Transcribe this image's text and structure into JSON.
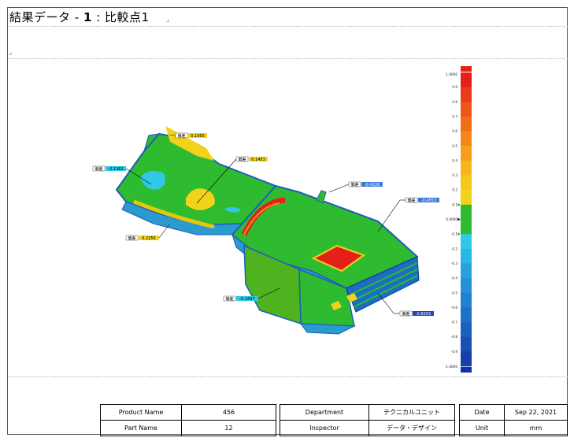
{
  "header": {
    "title_prefix": "結果データ - ",
    "title_num": "1",
    "title_sep": " :  ",
    "title_name": "比較点1"
  },
  "colors": {
    "accent": "#2a6cc7",
    "green": "#2fbb2f",
    "red": "#e5201a",
    "yellow": "#f2d21a"
  },
  "callouts": [
    {
      "label": "偏差",
      "value": "0.1065",
      "color": "#f2d21a"
    },
    {
      "label": "偏差",
      "value": "0.1453",
      "color": "#f2d21a"
    },
    {
      "label": "偏差",
      "value": "-0.1362",
      "color": "#2fc9e6"
    },
    {
      "label": "偏差",
      "value": "-0.4228",
      "color": "#3a7ad6"
    },
    {
      "label": "偏差",
      "value": "-0.4553",
      "color": "#3a7ad6"
    },
    {
      "label": "偏差",
      "value": "0.2255",
      "color": "#f2d21a"
    },
    {
      "label": "偏差",
      "value": "-0.1697",
      "color": "#2fc9e6"
    },
    {
      "label": "偏差",
      "value": "-0.8203",
      "color": "#1f47b5"
    }
  ],
  "scale": {
    "top": "1.0000",
    "bottom": "-1.0000",
    "ticks": [
      "0.9",
      "0.8",
      "0.7",
      "0.6",
      "0.5",
      "0.4",
      "0.3",
      "0.2",
      "0.1",
      "0.0000",
      "-0.1",
      "-0.2",
      "-0.3",
      "-0.4",
      "-0.5",
      "-0.6",
      "-0.7",
      "-0.8",
      "-0.9"
    ],
    "tol_upper": "0.1",
    "tol_lower": "-0.1"
  },
  "info": {
    "product_name_label": "Product Name",
    "product_name": "456",
    "part_name_label": "Part Name",
    "part_name": "12",
    "department_label": "Department",
    "department": "テクニカルユニット",
    "inspector_label": "Inspector",
    "inspector": "データ・デザイン",
    "date_label": "Date",
    "date": "Sep 22, 2021",
    "unit_label": "Unit",
    "unit": "mm"
  }
}
